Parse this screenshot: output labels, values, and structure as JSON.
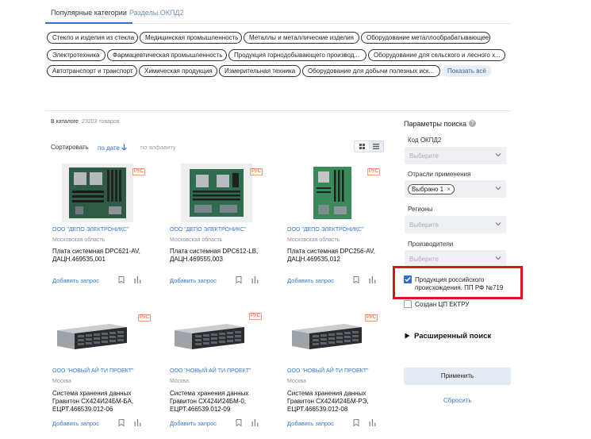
{
  "tabs": {
    "popular": "Популярные категории",
    "okpd": "Разделы ОКПД2"
  },
  "categories": {
    "row1": [
      "Стекло и изделия из стекла",
      "Медицинская промышленность",
      "Металлы и металлические изделия",
      "Оборудование металлообрабатывающее"
    ],
    "row2": [
      "Электротехника",
      "Фармацевтическая промышленность",
      "Продукция горнодобывающего производ...",
      "Оборудование для сельского и лесного х..."
    ],
    "row3": [
      "Автотранспорт и транспорт",
      "Химическая продукция",
      "Измерительная техника",
      "Оборудование для добычи полезных иск..."
    ],
    "show_all": "Показать всё"
  },
  "catalog": {
    "label": "В каталоге",
    "count": "23203 товаров"
  },
  "sort": {
    "label": "Сортировать",
    "by_date": "по дате",
    "by_alpha": "по алфавиту"
  },
  "products": [
    {
      "seller": "ООО \"ДЕПО ЭЛЕКТРОНИКС\"",
      "region": "Московская область",
      "title": "Плата системная DPC621-AV, ДАЦН.469535.001",
      "add": "Добавить запрос",
      "badge": "РУС"
    },
    {
      "seller": "ООО \"ДЕПО ЭЛЕКТРОНИКС\"",
      "region": "Московская область",
      "title": "Плата системная DPC612-LB, ДАЦН.469555.003",
      "add": "Добавить запрос",
      "badge": "РУС"
    },
    {
      "seller": "ООО \"ДЕПО ЭЛЕКТРОНИКС\"",
      "region": "Московская область",
      "title": "Плата системная DPC256-AV, ДАЦН.469535.012",
      "add": "Добавить запрос",
      "badge": "РУС"
    },
    {
      "seller": "ООО \"НОВЫЙ АЙ ТИ ПРОЕКТ\"",
      "region": "Москва",
      "title": "Система хранения данных Гравитон СХ424И24БМ-БА, ЕЦРТ.466539.012-06",
      "add": "Добавить запрос",
      "badge": "РУС"
    },
    {
      "seller": "ООО \"НОВЫЙ АЙ ТИ ПРОЕКТ\"",
      "region": "Москва",
      "title": "Система хранения данных Гравитон СХ424И24БМ-0, ЕЦРТ.466539.012-09",
      "add": "Добавить запрос",
      "badge": "РУС"
    },
    {
      "seller": "ООО \"НОВЫЙ АЙ ТИ ПРОЕКТ\"",
      "region": "Москва",
      "title": "Система хранения данных Гравитон СХ424И24БМ-РЭ, ЕЦРТ.466539.012-08",
      "add": "Добавить запрос",
      "badge": "РУС"
    }
  ],
  "filters": {
    "title": "Параметры поиска",
    "help": "?",
    "okpd": {
      "label": "Код ОКПД2",
      "placeholder": "Выберите"
    },
    "industry": {
      "label": "Отрасли применения",
      "tag": "Выбрано 1",
      "tag_remove": "×"
    },
    "regions": {
      "label": "Регионы",
      "placeholder": "Выберите"
    },
    "makers": {
      "label": "Производители",
      "placeholder": "Выберите"
    },
    "russian_product": {
      "label": "Продукция российского происхождения. ПП РФ №719",
      "checked": true
    },
    "ctr": {
      "label": "Создан ЦП ЕКТРУ",
      "checked": false
    },
    "advanced": "Расширенный поиск",
    "apply": "Применить",
    "reset": "Сбросить"
  },
  "colors": {
    "accent": "#2f6fcf",
    "highlight": "#d7191c",
    "badge": "#e0571b"
  }
}
